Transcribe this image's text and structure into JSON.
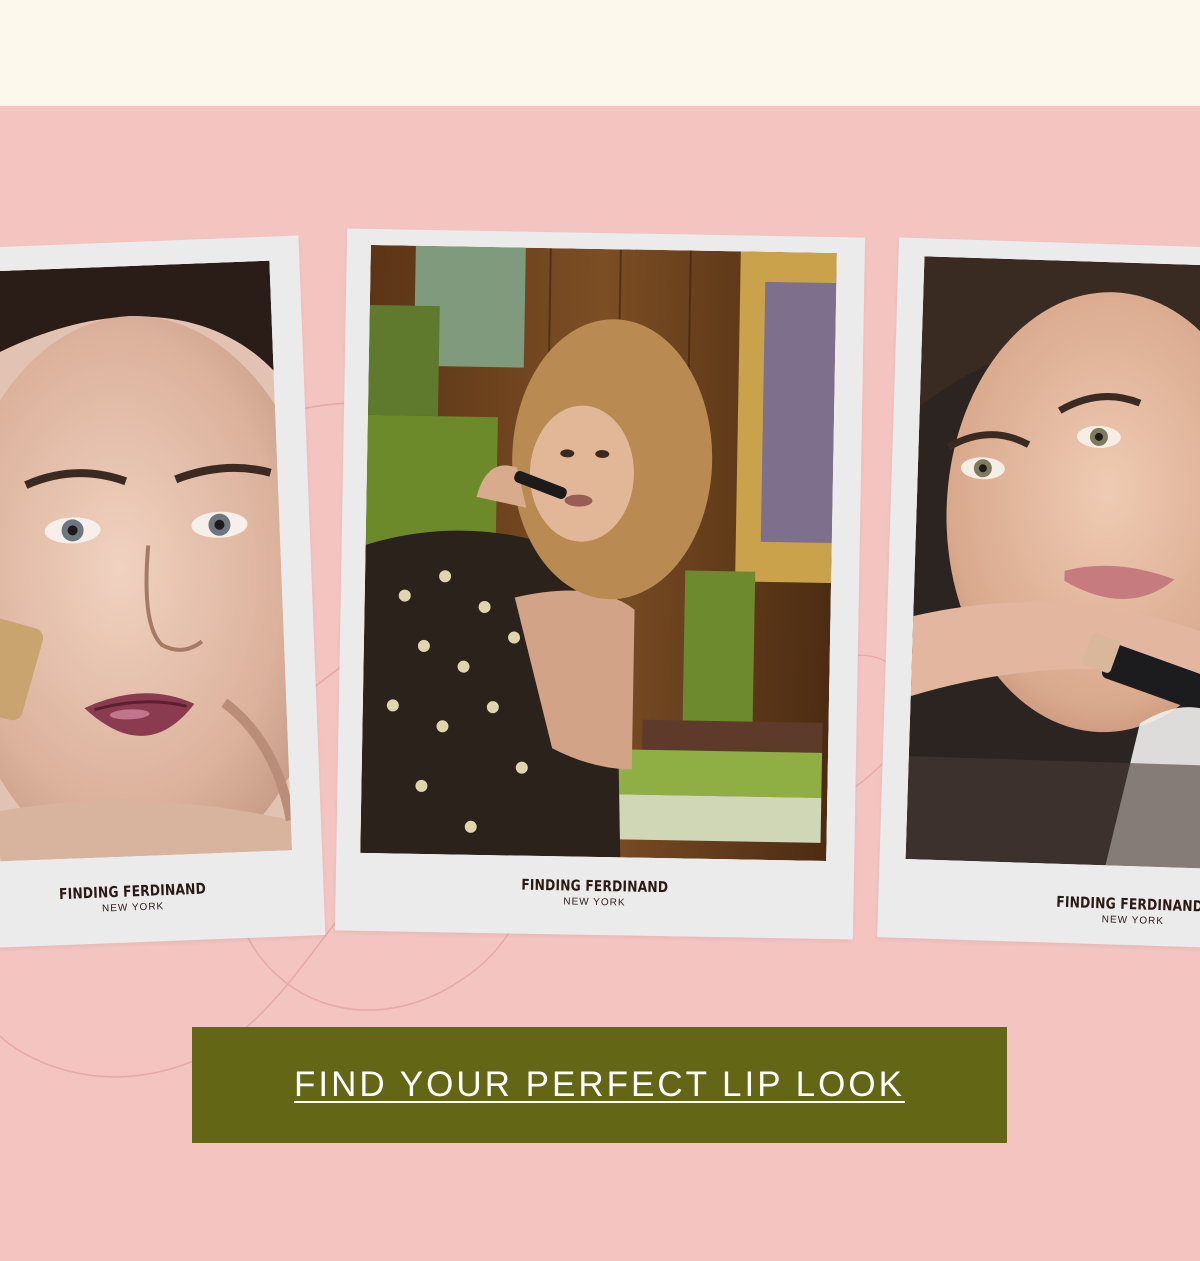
{
  "colors": {
    "top_band": "#fcf8ec",
    "background_pink": "#f4c4c1",
    "frame": "#ecebec",
    "button_olive": "#636715",
    "brand_text": "#2b1a14"
  },
  "polaroids": [
    {
      "name": "left",
      "image_icon": "model-portrait-glossy-lip-photo",
      "brand_name": "FINDING FERDINAND",
      "brand_location": "NEW YORK"
    },
    {
      "name": "center",
      "image_icon": "model-with-green-packaging-photo",
      "brand_name": "FINDING FERDINAND",
      "brand_location": "NEW YORK"
    },
    {
      "name": "right",
      "image_icon": "model-holding-lipstick-photo",
      "brand_name": "FINDING FERDINAND",
      "brand_location": "NEW YORK"
    }
  ],
  "cta": {
    "label": "FIND YOUR PERFECT LIP LOOK"
  }
}
